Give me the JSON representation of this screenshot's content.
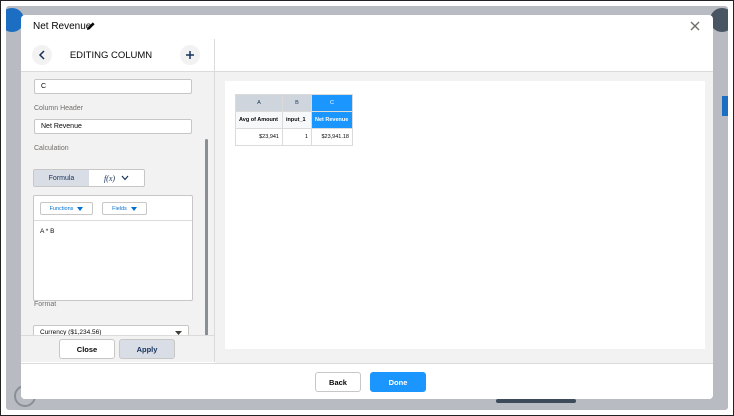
{
  "modal": {
    "title": "Net Revenue",
    "close_label": "×"
  },
  "panel": {
    "title": "EDITING COLUMN",
    "prev_value": "C",
    "column_header_label": "Column Header",
    "column_header_value": "Net Revenue",
    "calculation_label": "Calculation",
    "formula_tab": "Formula",
    "fx_label": "f(x)",
    "functions_label": "Functions",
    "fields_label": "Fields",
    "formula_text": "A * B",
    "format_label": "Format",
    "format_value": "Currency ($1,234.56)",
    "close_button": "Close",
    "apply_button": "Apply"
  },
  "table": {
    "column_letters": [
      "A",
      "B",
      "C"
    ],
    "headers": [
      "Avg of Amount",
      "input_1",
      "Net Revenue"
    ],
    "row": [
      "$23,941",
      "1",
      "$23,941.18"
    ],
    "selected_column": 2
  },
  "footer": {
    "back_label": "Back",
    "done_label": "Done"
  },
  "colors": {
    "brand": "#0176d3",
    "selected_column": "#1b96ff",
    "text": "#16325c"
  }
}
